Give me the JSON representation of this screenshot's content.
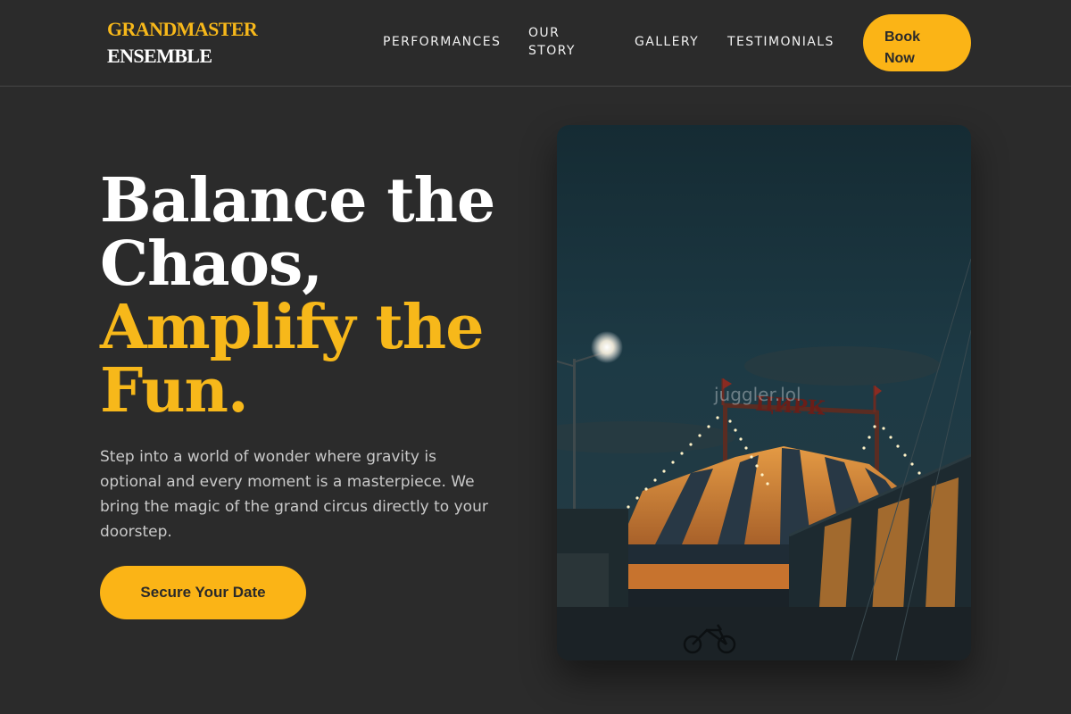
{
  "brand": {
    "line1": "GRANDMASTER",
    "line2": "ENSEMBLE"
  },
  "nav": {
    "performances": "PERFORMANCES",
    "our_story": "OUR STORY",
    "gallery": "GALLERY",
    "testimonials": "TESTIMONIALS",
    "book_now": "Book Now"
  },
  "hero": {
    "title_line1": "Balance the",
    "title_line2": "Chaos,",
    "title_line3": "Amplify the",
    "title_line4": "Fun.",
    "description": "Step into a world of wonder where gravity is optional and every moment is a masterpiece. We bring the magic of the grand circus directly to your doorstep.",
    "cta": "Secure Your Date"
  },
  "photo": {
    "watermark": "juggler.lol",
    "sign_text": "ЦИРК"
  },
  "colors": {
    "accent": "#f7b81a",
    "background": "#2b2b2b"
  }
}
